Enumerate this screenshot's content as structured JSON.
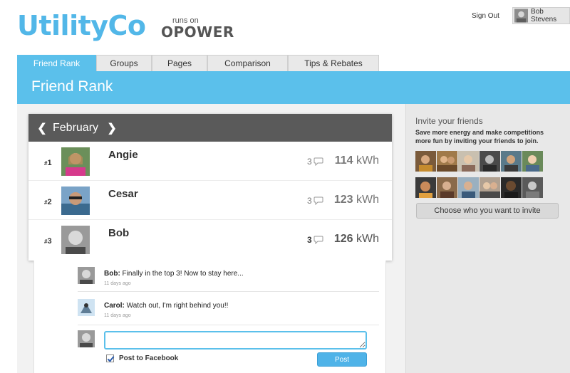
{
  "header": {
    "brand": "UtilityCo",
    "runs_on": "runs on",
    "opower": "OPOWER",
    "sign_out": "Sign Out",
    "user_name": "Bob Stevens"
  },
  "tabs": [
    {
      "label": "Friend Rank",
      "active": true
    },
    {
      "label": "Groups"
    },
    {
      "label": "Pages"
    },
    {
      "label": "Comparison"
    },
    {
      "label": "Tips & Rebates"
    }
  ],
  "page_title": "Friend Rank",
  "leaderboard": {
    "month": "February",
    "rows": [
      {
        "rank": "1",
        "rank_prefix": "#",
        "name": "Angie",
        "comments": "3",
        "kwh": "114",
        "unit": "kWh"
      },
      {
        "rank": "2",
        "rank_prefix": "#",
        "name": "Cesar",
        "comments": "3",
        "kwh": "123",
        "unit": "kWh"
      },
      {
        "rank": "3",
        "rank_prefix": "#",
        "name": "Bob",
        "comments": "3",
        "kwh": "126",
        "unit": "kWh"
      }
    ]
  },
  "comments": [
    {
      "author": "Bob:",
      "text": " Finally in the top 3! Now to stay here...",
      "time": "11 days ago"
    },
    {
      "author": "Carol:",
      "text": " Watch out, I'm right behind you!!",
      "time": "11 days ago"
    }
  ],
  "reply": {
    "value": "",
    "post_to_facebook": "Post to Facebook",
    "post_button": "Post"
  },
  "sidebar": {
    "title": "Invite your friends",
    "description": "Save more energy and make competitions more fun by inviting your friends to join.",
    "choose_button": "Choose who you want to invite"
  },
  "colors": {
    "accent": "#5bc0eb",
    "header_bar": "#5a5a5a"
  }
}
